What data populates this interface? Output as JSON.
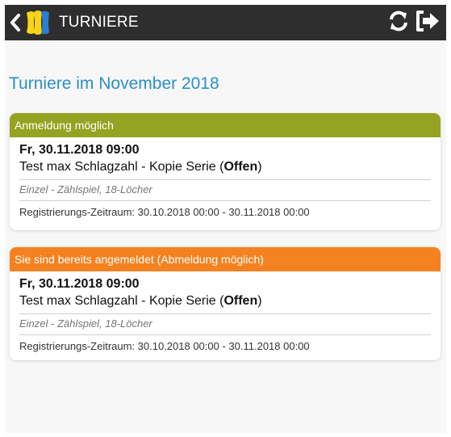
{
  "header": {
    "title": "TURNIERE",
    "back_icon": "chevron-left-icon",
    "logo_icon": "app-logo-icon",
    "refresh_icon": "refresh-icon",
    "logout_icon": "logout-icon",
    "colors": {
      "bar": "#2e2e2e",
      "logo_yellow": "#f7d417",
      "logo_blue": "#2a7fd4"
    }
  },
  "page": {
    "heading": "Turniere im November 2018",
    "heading_color": "#2a8fc9"
  },
  "tournaments": [
    {
      "status": "Anmeldung möglich",
      "status_color": "#94a322",
      "date": "Fr, 30.11.2018 09:00",
      "name": "Test max Schlagzahl - Kopie Serie (",
      "state": "Offen",
      "name_end": ")",
      "meta": "Einzel - Zählspiel, 18-Löcher",
      "registration": "Registrierungs-Zeitraum: 30.10.2018 00:00 - 30.11.2018 00:00"
    },
    {
      "status": "Sie sind bereits angemeldet (Abmeldung möglich)",
      "status_color": "#f58220",
      "date": "Fr, 30.11.2018 09:00",
      "name": "Test max Schlagzahl - Kopie Serie (",
      "state": "Offen",
      "name_end": ")",
      "meta": "Einzel - Zählspiel, 18-Löcher",
      "registration": "Registrierungs-Zeitraum: 30.10.2018 00:00 - 30.11.2018 00:00"
    }
  ]
}
